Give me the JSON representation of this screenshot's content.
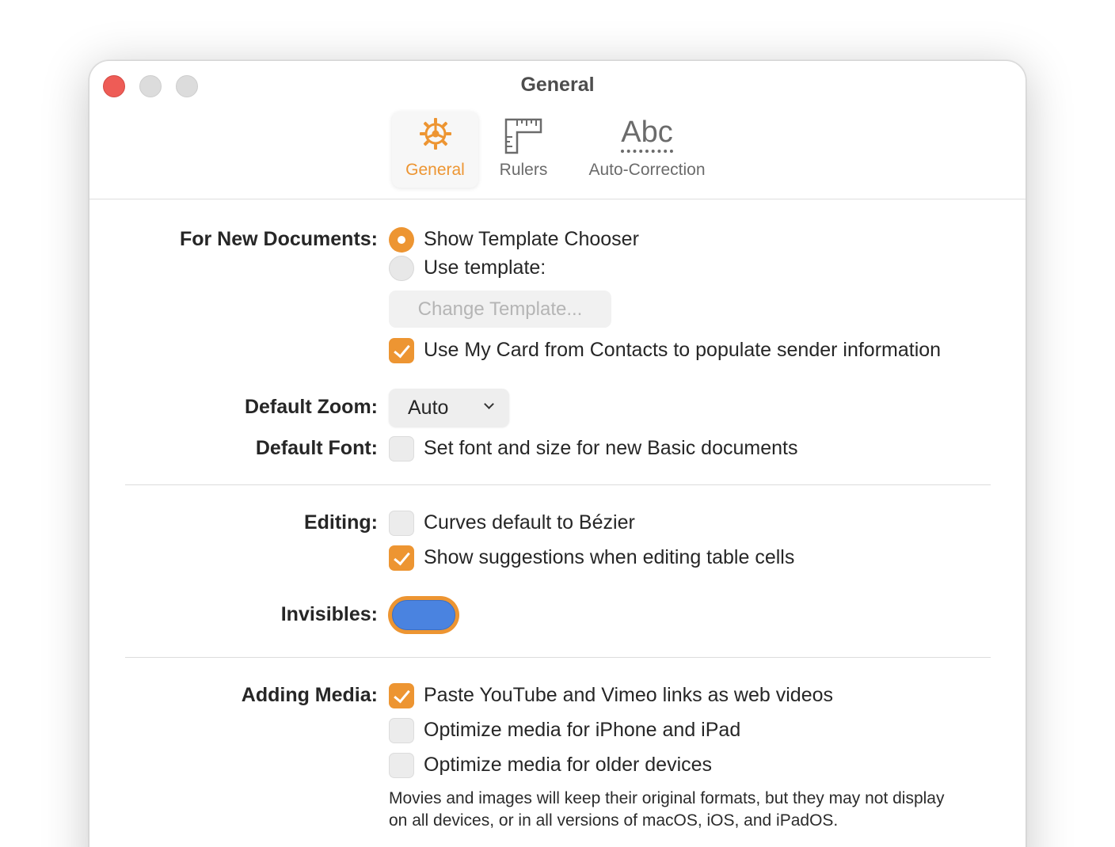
{
  "window": {
    "title": "General"
  },
  "toolbar": {
    "items": [
      {
        "label": "General",
        "icon": "gear-icon",
        "active": true
      },
      {
        "label": "Rulers",
        "icon": "ruler-icon",
        "active": false
      },
      {
        "label": "Auto-Correction",
        "icon": "abc-icon",
        "icon_text": "Abc",
        "active": false
      }
    ]
  },
  "colors": {
    "accent": "#ed9532",
    "close": "#ee5c56",
    "invisibles_color": "#4a83e0"
  },
  "new_documents": {
    "label": "For New Documents:",
    "option_chooser": "Show Template Chooser",
    "option_chooser_selected": true,
    "option_template": "Use template:",
    "option_template_selected": false,
    "change_template_button": "Change Template...",
    "my_card": "Use My Card from Contacts to populate sender information",
    "my_card_checked": true
  },
  "default_zoom": {
    "label": "Default Zoom:",
    "value": "Auto"
  },
  "default_font": {
    "label": "Default Font:",
    "text": "Set font and size for new Basic documents",
    "checked": false
  },
  "editing": {
    "label": "Editing:",
    "bezier": "Curves default to Bézier",
    "bezier_checked": false,
    "suggestions": "Show suggestions when editing table cells",
    "suggestions_checked": true
  },
  "invisibles": {
    "label": "Invisibles:"
  },
  "adding_media": {
    "label": "Adding Media:",
    "paste_links": "Paste YouTube and Vimeo links as web videos",
    "paste_links_checked": true,
    "optimize_iphone": "Optimize media for iPhone and iPad",
    "optimize_iphone_checked": false,
    "optimize_older": "Optimize media for older devices",
    "optimize_older_checked": false,
    "note": "Movies and images will keep their original formats, but they may not display on all devices, or in all versions of macOS, iOS, and iPadOS."
  }
}
